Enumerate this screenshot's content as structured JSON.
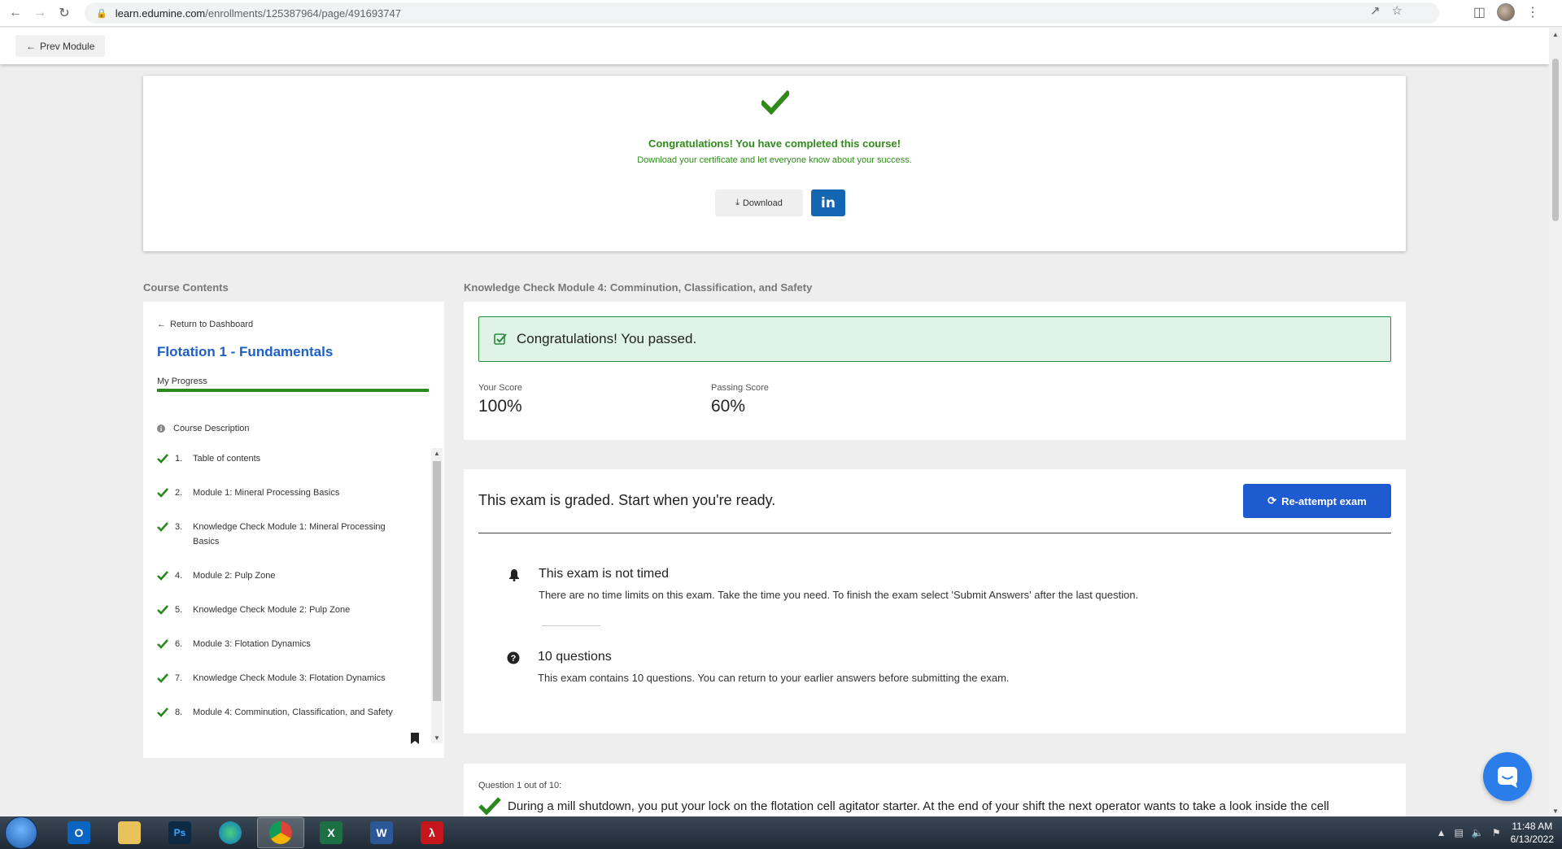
{
  "browser": {
    "url_host": "learn.edumine.com",
    "url_path": "/enrollments/125387964/page/491693747"
  },
  "topbar": {
    "prev_label": "Prev Module"
  },
  "congrats": {
    "title": "Congratulations! You have completed this course!",
    "subtitle": "Download your certificate and let everyone know about your success.",
    "download_label": "Download",
    "linkedin_label": "in"
  },
  "sidebar": {
    "heading": "Course Contents",
    "return_label": "Return to Dashboard",
    "course_title": "Flotation 1 - Fundamentals",
    "progress_label": "My Progress",
    "progress_fraction": 1.0,
    "description_label": "Course Description",
    "items": [
      {
        "num": "1.",
        "label": "Table of contents"
      },
      {
        "num": "2.",
        "label": "Module 1: Mineral Processing Basics"
      },
      {
        "num": "3.",
        "label": "Knowledge Check Module 1: Mineral Processing Basics"
      },
      {
        "num": "4.",
        "label": "Module 2: Pulp Zone"
      },
      {
        "num": "5.",
        "label": "Knowledge Check Module 2: Pulp Zone"
      },
      {
        "num": "6.",
        "label": "Module 3: Flotation Dynamics"
      },
      {
        "num": "7.",
        "label": "Knowledge Check Module 3: Flotation Dynamics"
      },
      {
        "num": "8.",
        "label": "Module 4: Comminution, Classification, and Safety"
      }
    ]
  },
  "main": {
    "heading": "Knowledge Check Module 4: Comminution, Classification, and Safety",
    "pass_message": "Congratulations! You passed.",
    "your_score_label": "Your Score",
    "your_score": "100%",
    "passing_score_label": "Passing Score",
    "passing_score": "60%"
  },
  "exam": {
    "title": "This exam is graded. Start when you're ready.",
    "reattempt_label": "Re-attempt exam",
    "timed_title": "This exam is not timed",
    "timed_text": "There are no time limits on this exam. Take the time you need.  To finish the exam select 'Submit Answers' after the last question.",
    "questions_title": "10 questions",
    "questions_text": "This exam contains 10 questions. You can return to your earlier answers before submitting the exam."
  },
  "question": {
    "label": "Question 1 out of 10:",
    "text": "During a mill shutdown, you put your lock on the flotation cell agitator starter. At the end of your shift the next operator wants to take a look inside the cell"
  },
  "taskbar": {
    "time": "11:48 AM",
    "date": "6/13/2022"
  },
  "colors": {
    "success_green": "#2f8a1a",
    "primary_blue": "#1f5bd0",
    "title_blue": "#1e5fc5",
    "linkedin_blue": "#1466b2",
    "pass_bg": "#dff3e6"
  }
}
